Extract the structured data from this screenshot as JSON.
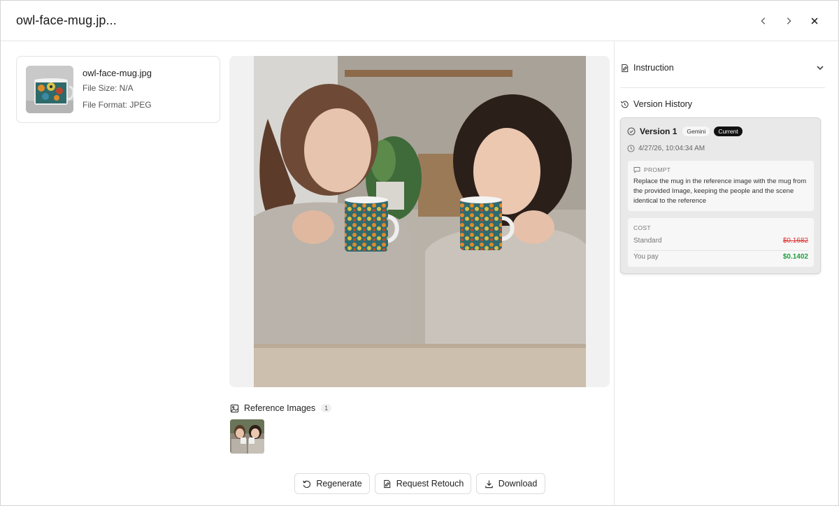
{
  "header": {
    "title": "owl-face-mug.jp..."
  },
  "file": {
    "name": "owl-face-mug.jpg",
    "size": "File Size: N/A",
    "format": "File Format: JPEG"
  },
  "reference": {
    "label": "Reference Images",
    "count": "1"
  },
  "actions": {
    "regenerate": "Regenerate",
    "request_retouch": "Request Retouch",
    "download": "Download"
  },
  "panel": {
    "instruction": "Instruction",
    "version_history": "Version History",
    "version": {
      "title": "Version 1",
      "model_badge": "Gemini",
      "status_badge": "Current",
      "timestamp": "4/27/26, 10:04:34 AM",
      "prompt_label": "PROMPT",
      "prompt_text": "Replace the mug in the reference image with the mug from the provided Image, keeping the people and the scene identical to the reference",
      "cost_label": "COST",
      "standard_label": "Standard",
      "standard_value": "$0.1682",
      "you_pay_label": "You pay",
      "you_pay_value": "$0.1402"
    }
  },
  "colors": {
    "accent_green": "#1e9e3e",
    "strike_red": "#d33333",
    "badge_dark": "#111111"
  }
}
